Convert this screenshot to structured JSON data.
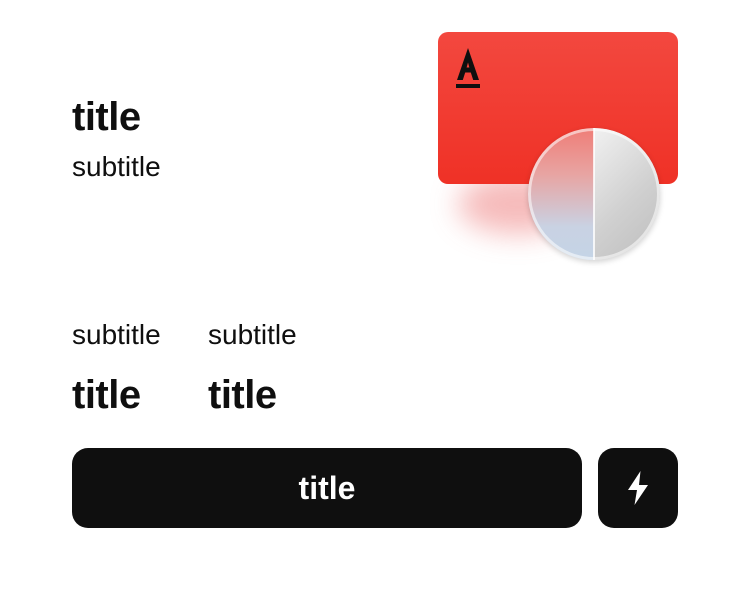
{
  "header": {
    "title": "title",
    "subtitle": "subtitle"
  },
  "card": {
    "logo_letter": "A",
    "brand_color": "#ef3126",
    "icons": [
      "bank-logo-icon",
      "coin-icon"
    ]
  },
  "stats": [
    {
      "label": "subtitle",
      "value": "title"
    },
    {
      "label": "subtitle",
      "value": "title"
    }
  ],
  "actions": {
    "primary_label": "title",
    "secondary_icon": "lightning-icon"
  },
  "colors": {
    "text": "#0f0f0f",
    "button_bg": "#0f0f0f",
    "button_text": "#ffffff"
  }
}
